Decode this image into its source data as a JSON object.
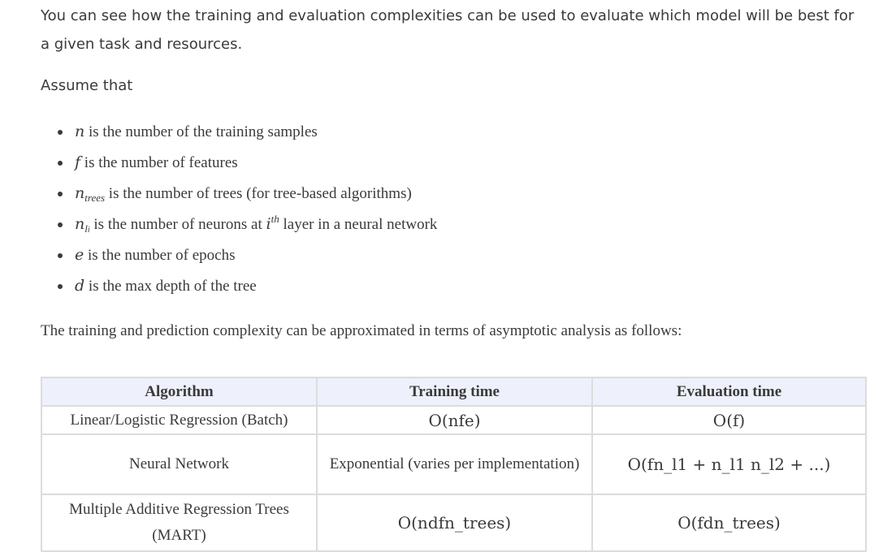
{
  "intro": "You can see how the training and evaluation complexities can be used to evaluate which model will be best for a given task and resources.",
  "assume": "Assume that",
  "bullets": [
    {
      "var": "n",
      "text": " is the number of the training samples"
    },
    {
      "var": "f",
      "text": " is the number of features"
    },
    {
      "var": "n",
      "sub": "trees",
      "text": " is the number of trees (for tree-based algorithms)"
    },
    {
      "var": "n",
      "sub": "l",
      "subsub": "i",
      "text_before": " is the number of neurons at ",
      "sup_base": "i",
      "sup": "th",
      "text": " layer in a neural network"
    },
    {
      "var": "e",
      "text": " is the number of epochs"
    },
    {
      "var": "d",
      "text": " is the max depth of the tree"
    }
  ],
  "summary": "The training and prediction complexity can be approximated in terms of asymptotic analysis as follows:",
  "table": {
    "headers": [
      "Algorithm",
      "Training time",
      "Evaluation time"
    ],
    "rows": [
      {
        "algorithm": "Linear/Logistic Regression (Batch)",
        "training": "O(nfe)",
        "evaluation": "O(f)"
      },
      {
        "algorithm": "Neural Network",
        "training": "Exponential (varies per implementation)",
        "evaluation": "O(fn_l1 + n_l1 n_l2 + ...)"
      },
      {
        "algorithm": "Multiple Additive Regression Trees (MART)",
        "training": "O(ndfn_trees)",
        "evaluation": "O(fdn_trees)"
      }
    ]
  }
}
